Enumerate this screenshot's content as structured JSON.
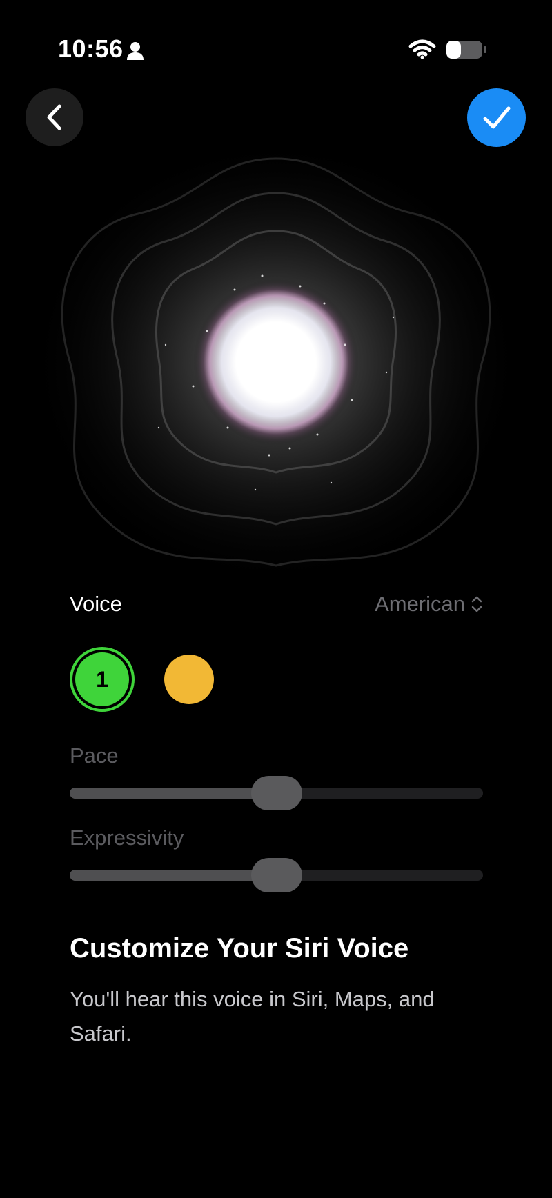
{
  "status_bar": {
    "time": "10:56",
    "icons": [
      "person-icon",
      "wifi-icon",
      "battery-icon"
    ]
  },
  "nav": {
    "back_icon": "chevron-left-icon",
    "done_icon": "checkmark-icon",
    "done_color": "#1a8cf5"
  },
  "voice": {
    "label": "Voice",
    "accent": "American",
    "accent_icon": "chevron-up-down-icon",
    "options": [
      {
        "number": "1",
        "color": "#3fd43a",
        "selected": true
      },
      {
        "number": "",
        "color": "#f2b835",
        "selected": false
      }
    ]
  },
  "sliders": {
    "pace": {
      "label": "Pace",
      "value": 0.5
    },
    "expressivity": {
      "label": "Expressivity",
      "value": 0.5
    }
  },
  "info": {
    "title": "Customize Your Siri Voice",
    "description": "You'll hear this voice in Siri, Maps, and Safari."
  }
}
